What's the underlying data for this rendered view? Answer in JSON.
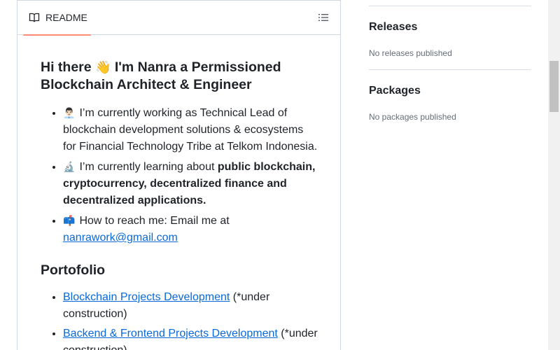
{
  "readme": {
    "tab_label": "README",
    "intro": {
      "heading_prefix": "Hi there",
      "wave": "👋",
      "heading_suffix": "I'm Nanra a Permissioned Blockchain Architect & Engineer"
    },
    "bullets": [
      {
        "emoji": "👨🏻‍💼",
        "text": "I’m currently working as Technical Lead of blockchain development solutions & ecosystems for Financial Technology Tribe at Telkom Indonesia."
      },
      {
        "emoji": "🔬",
        "prefix": "I’m currently learning about ",
        "bold": "public blockchain, cryptocurrency, decentralized finance and decentralized applications."
      },
      {
        "emoji": "📫",
        "prefix": "How to reach me: Email me at ",
        "link": "nanrawork@gmail.com"
      }
    ],
    "portfolio": {
      "heading": "Portofolio",
      "items": [
        {
          "link": "Blockchain Projects Development",
          "suffix": " (*under construction)"
        },
        {
          "link": "Backend & Frontend Projects Development",
          "suffix": " (*under construction)"
        }
      ]
    }
  },
  "sidebar": {
    "releases": {
      "title": "Releases",
      "empty": "No releases published"
    },
    "packages": {
      "title": "Packages",
      "empty": "No packages published"
    }
  },
  "colors": {
    "link": "#0969da",
    "tab_underline": "#fd8c73",
    "border": "#d0d7de",
    "muted": "#656d76"
  }
}
